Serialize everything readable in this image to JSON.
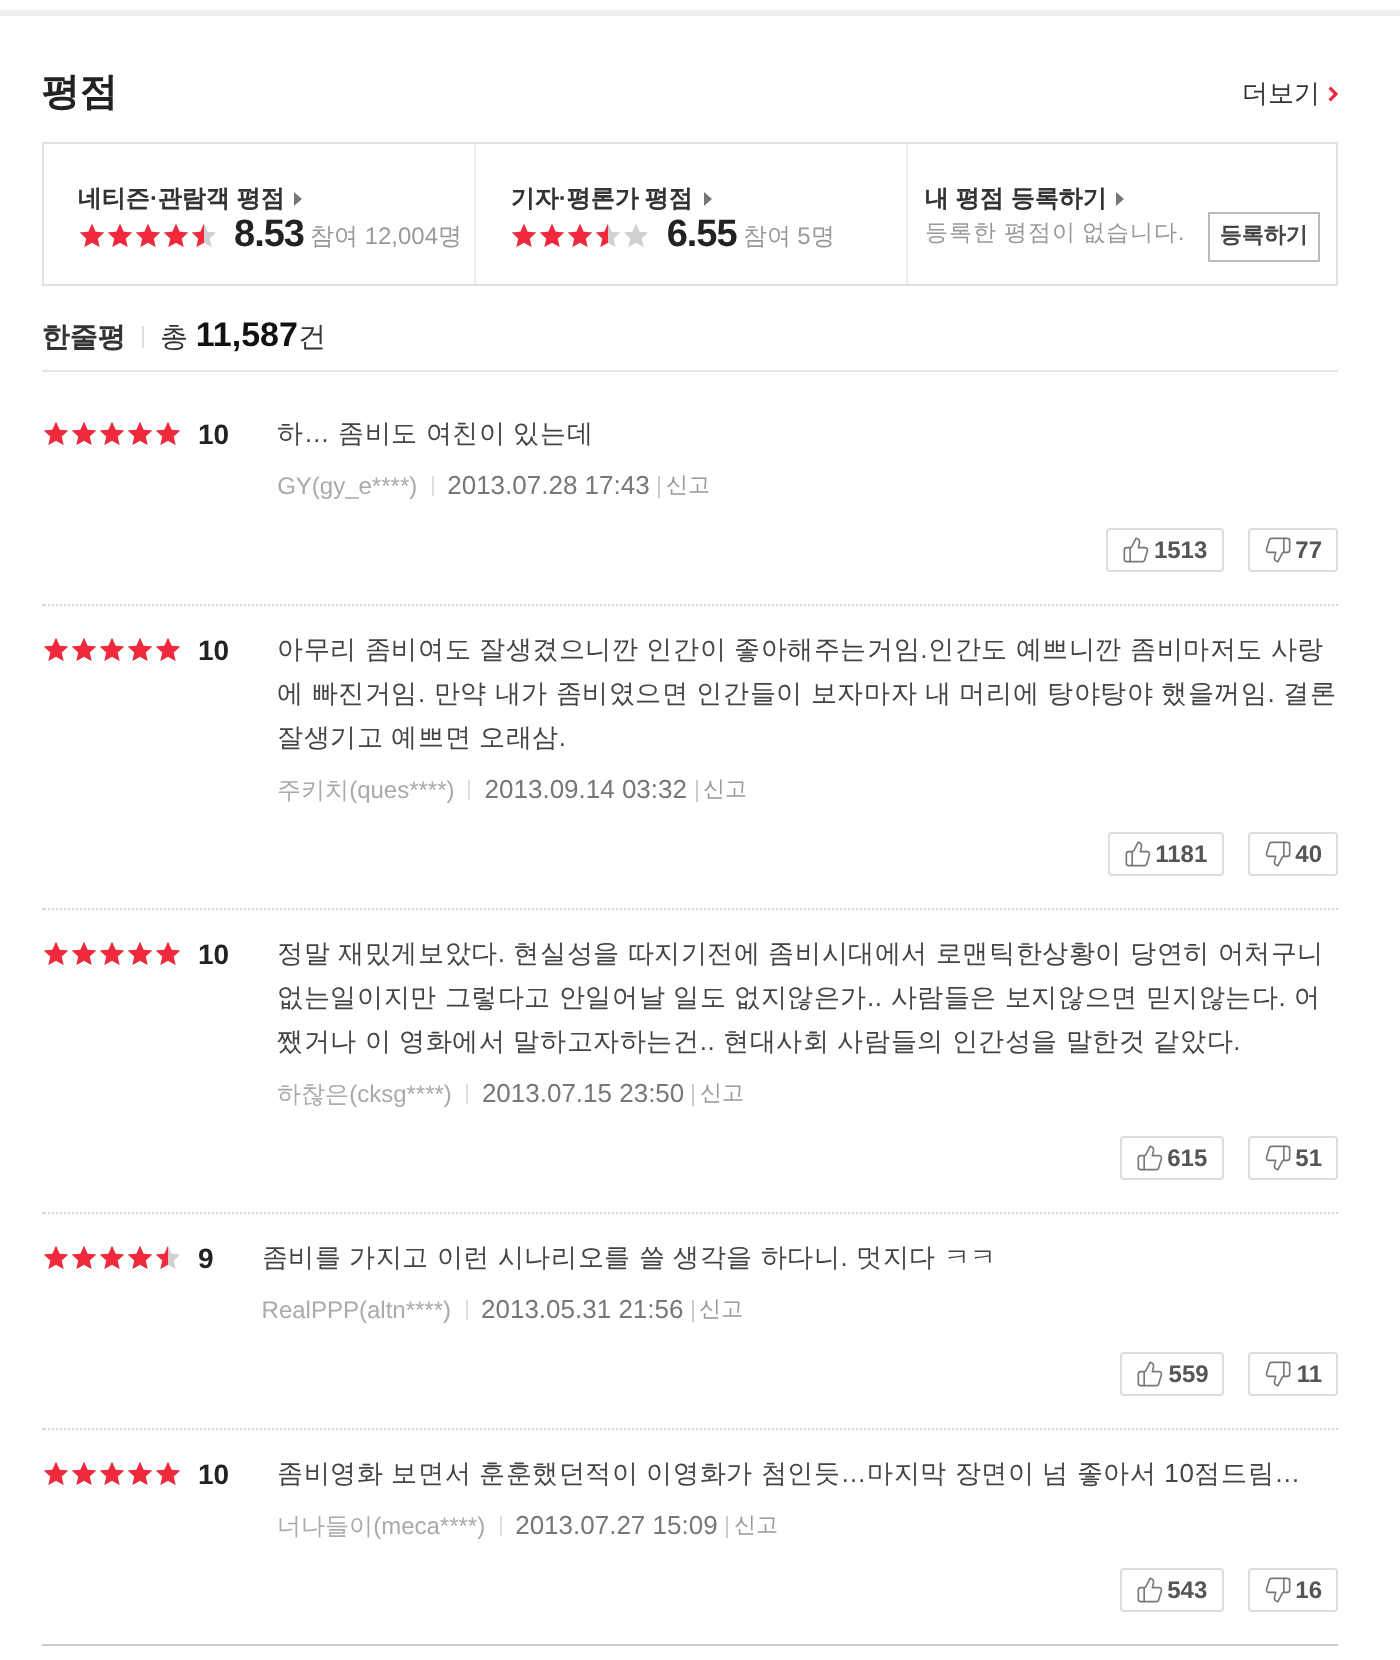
{
  "section": {
    "title": "평점",
    "more_link": "더보기"
  },
  "rating_summary": [
    {
      "kind": "score",
      "title": "네티즌·관람객 평점",
      "stars": 4.5,
      "score": "8.53",
      "participants": "참여 12,004명"
    },
    {
      "kind": "score",
      "title": "기자·평론가 평점",
      "stars": 3.5,
      "score": "6.55",
      "participants": "참여 5명"
    },
    {
      "kind": "register",
      "title": "내 평점 등록하기",
      "message": "등록한 평점이 없습니다.",
      "button": "등록하기"
    }
  ],
  "comments_header": {
    "title": "한줄평",
    "total": "총 **11,587**건"
  },
  "reviews": [
    {
      "stars": 5,
      "score": "10",
      "text": "하… 좀비도 여친이 있는데",
      "author": "GY(gy_e****)",
      "date": "2013.07.28 17:43",
      "report": "신고",
      "likes": "1513",
      "dislikes": "77"
    },
    {
      "stars": 5,
      "score": "10",
      "text": "아무리 좀비여도 잘생겼으니깐 인간이 좋아해주는거임.인간도 예쁘니깐 좀비마저도 사랑에 빠진거임. 만약 내가 좀비였으면 인간들이 보자마자 내 머리에 탕야탕야 했을꺼임. 결론 잘생기고 예쁘면 오래삼.",
      "author": "주키치(ques****)",
      "date": "2013.09.14 03:32",
      "report": "신고",
      "likes": "1181",
      "dislikes": "40"
    },
    {
      "stars": 5,
      "score": "10",
      "text": "정말 재밌게보았다. 현실성을 따지기전에 좀비시대에서 로맨틱한상황이 당연히 어처구니없는일이지만 그렇다고 안일어날 일도 없지않은가.. 사람들은 보지않으면 믿지않는다. 어쨌거나 이 영화에서 말하고자하는건.. 현대사회 사람들의 인간성을 말한것 같았다.",
      "author": "하찮은(cksg****)",
      "date": "2013.07.15 23:50",
      "report": "신고",
      "likes": "615",
      "dislikes": "51"
    },
    {
      "stars": 4.5,
      "score": "9",
      "text": "좀비를 가지고 이런 시나리오를 쓸 생각을 하다니. 멋지다 ㅋㅋ",
      "author": "RealPPP(altn****)",
      "date": "2013.05.31 21:56",
      "report": "신고",
      "likes": "559",
      "dislikes": "11"
    },
    {
      "stars": 5,
      "score": "10",
      "text": "좀비영화 보면서 훈훈했던적이 이영화가 첨인듯…마지막 장면이 넘 좋아서 10점드림…",
      "author": "너나들이(meca****)",
      "date": "2013.07.27 15:09",
      "report": "신고",
      "likes": "543",
      "dislikes": "16"
    }
  ]
}
